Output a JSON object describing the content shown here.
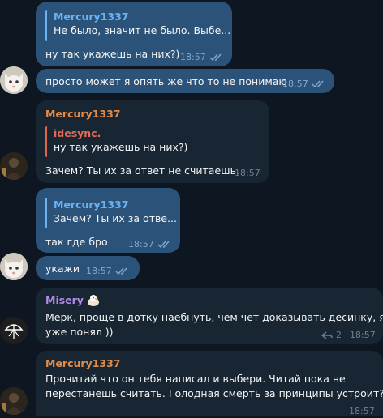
{
  "messages": [
    {
      "quote_name": "Mercury1337",
      "quote_text": "Не было, значит не было. Выбе...",
      "text": "ну так укажешь на них?)",
      "time": "18:57"
    },
    {
      "text": "просто может я опять же что то не понимаю",
      "time": "18:57"
    },
    {
      "sender": "Mercury1337",
      "quote_name": "idesync.",
      "quote_text": "ну так укажешь на них?)",
      "text": "Зачем? Ты их за ответ не считаешь.",
      "time": "18:57"
    },
    {
      "quote_name": "Mercury1337",
      "quote_text": "Зачем? Ты их за отве...",
      "text": "так где бро",
      "time": "18:57"
    },
    {
      "text": "укажи",
      "time": "18:57"
    },
    {
      "sender": "Misery",
      "text_line1": "Мерк, проще в дотку наебнуть, чем чет доказывать десинку, я",
      "text_line2": "уже понял ))",
      "reply_count": "2",
      "time": "18:57"
    },
    {
      "sender": "Mercury1337",
      "text_line1": "Прочитай что он тебя написал и выбери. Читай пока не",
      "text_line2": "перестанешь считать. Голодная смерть за принципы устроит?",
      "time": "18:57"
    }
  ],
  "colors": {
    "background": "#0e1621",
    "outgoing": "#2b5278",
    "incoming": "#182533",
    "mercury": "#e38c48",
    "misery": "#b18aea",
    "accent": "#6ab3f3"
  },
  "icons": [
    "double-check-icon",
    "reply-arrow-icon",
    "cat-avatar",
    "dark-avatar",
    "umbrella-logo-avatar",
    "eagle-emoji"
  ]
}
